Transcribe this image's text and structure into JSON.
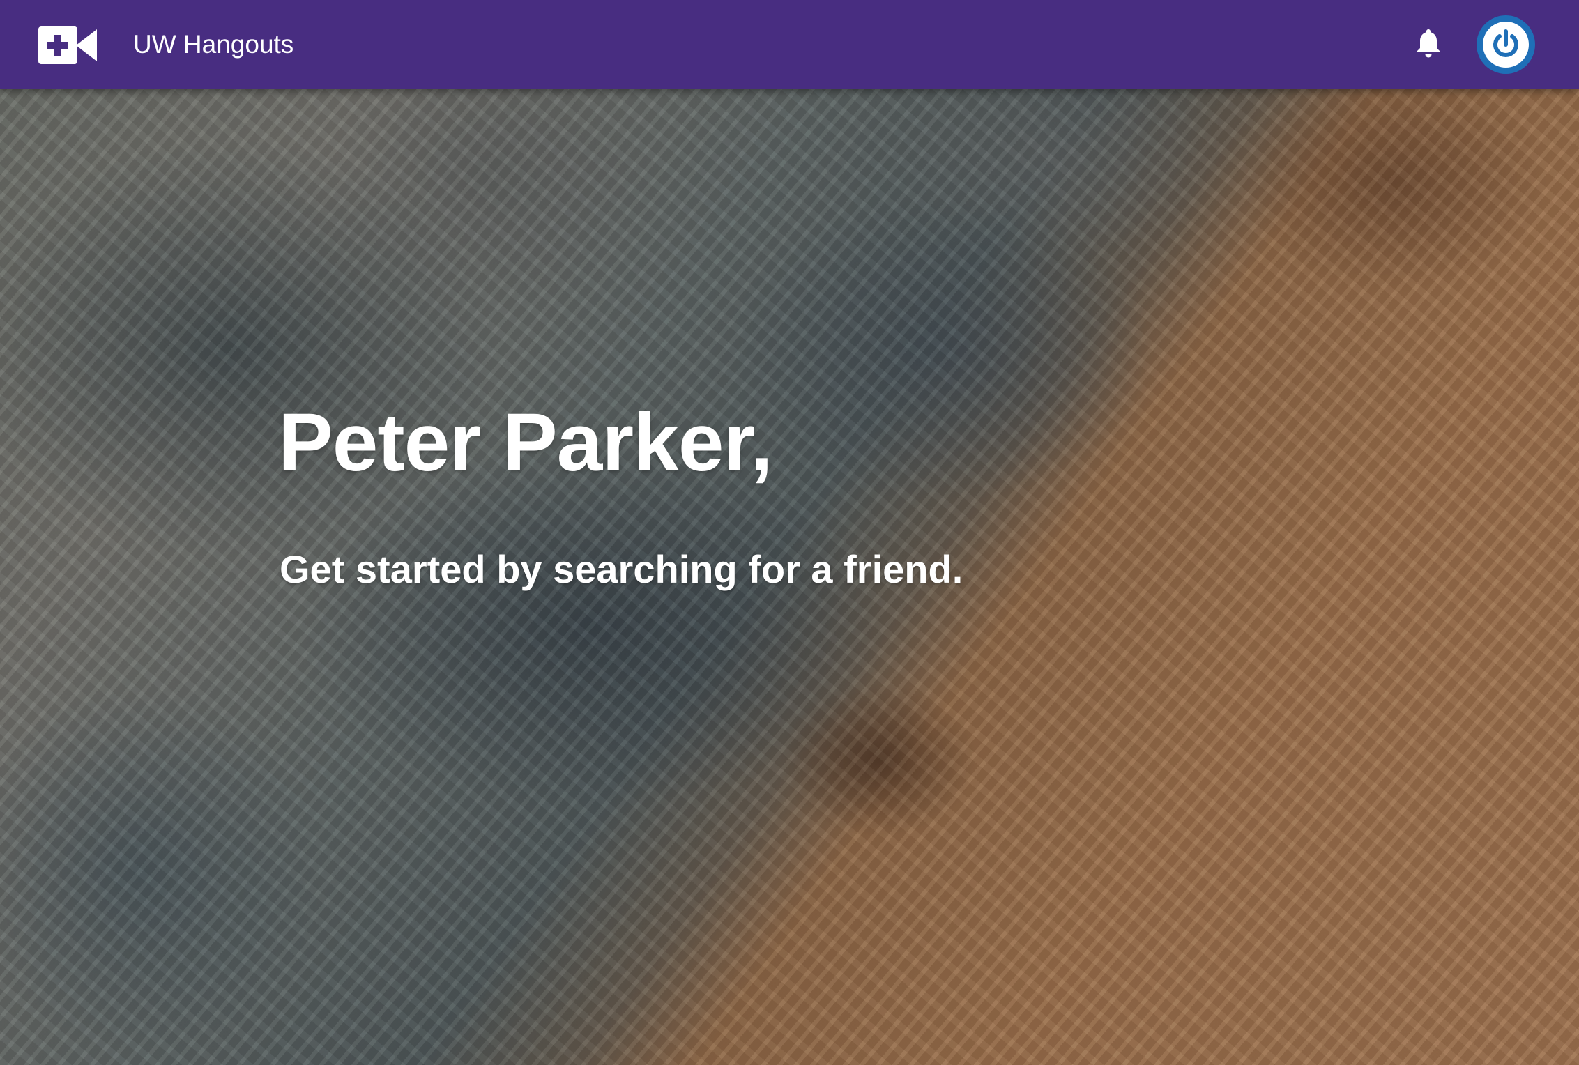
{
  "app": {
    "title": "UW Hangouts",
    "accent_color": "#482d81",
    "logo_icon": "video-call-add-icon",
    "notification_icon": "bell-icon",
    "power_icon": "power-icon",
    "power_button_color": "#1f6fb7"
  },
  "hero": {
    "greeting": "Peter Parker,",
    "subtitle": "Get started by searching for a friend.",
    "background": "aerial desert landscape photo"
  }
}
